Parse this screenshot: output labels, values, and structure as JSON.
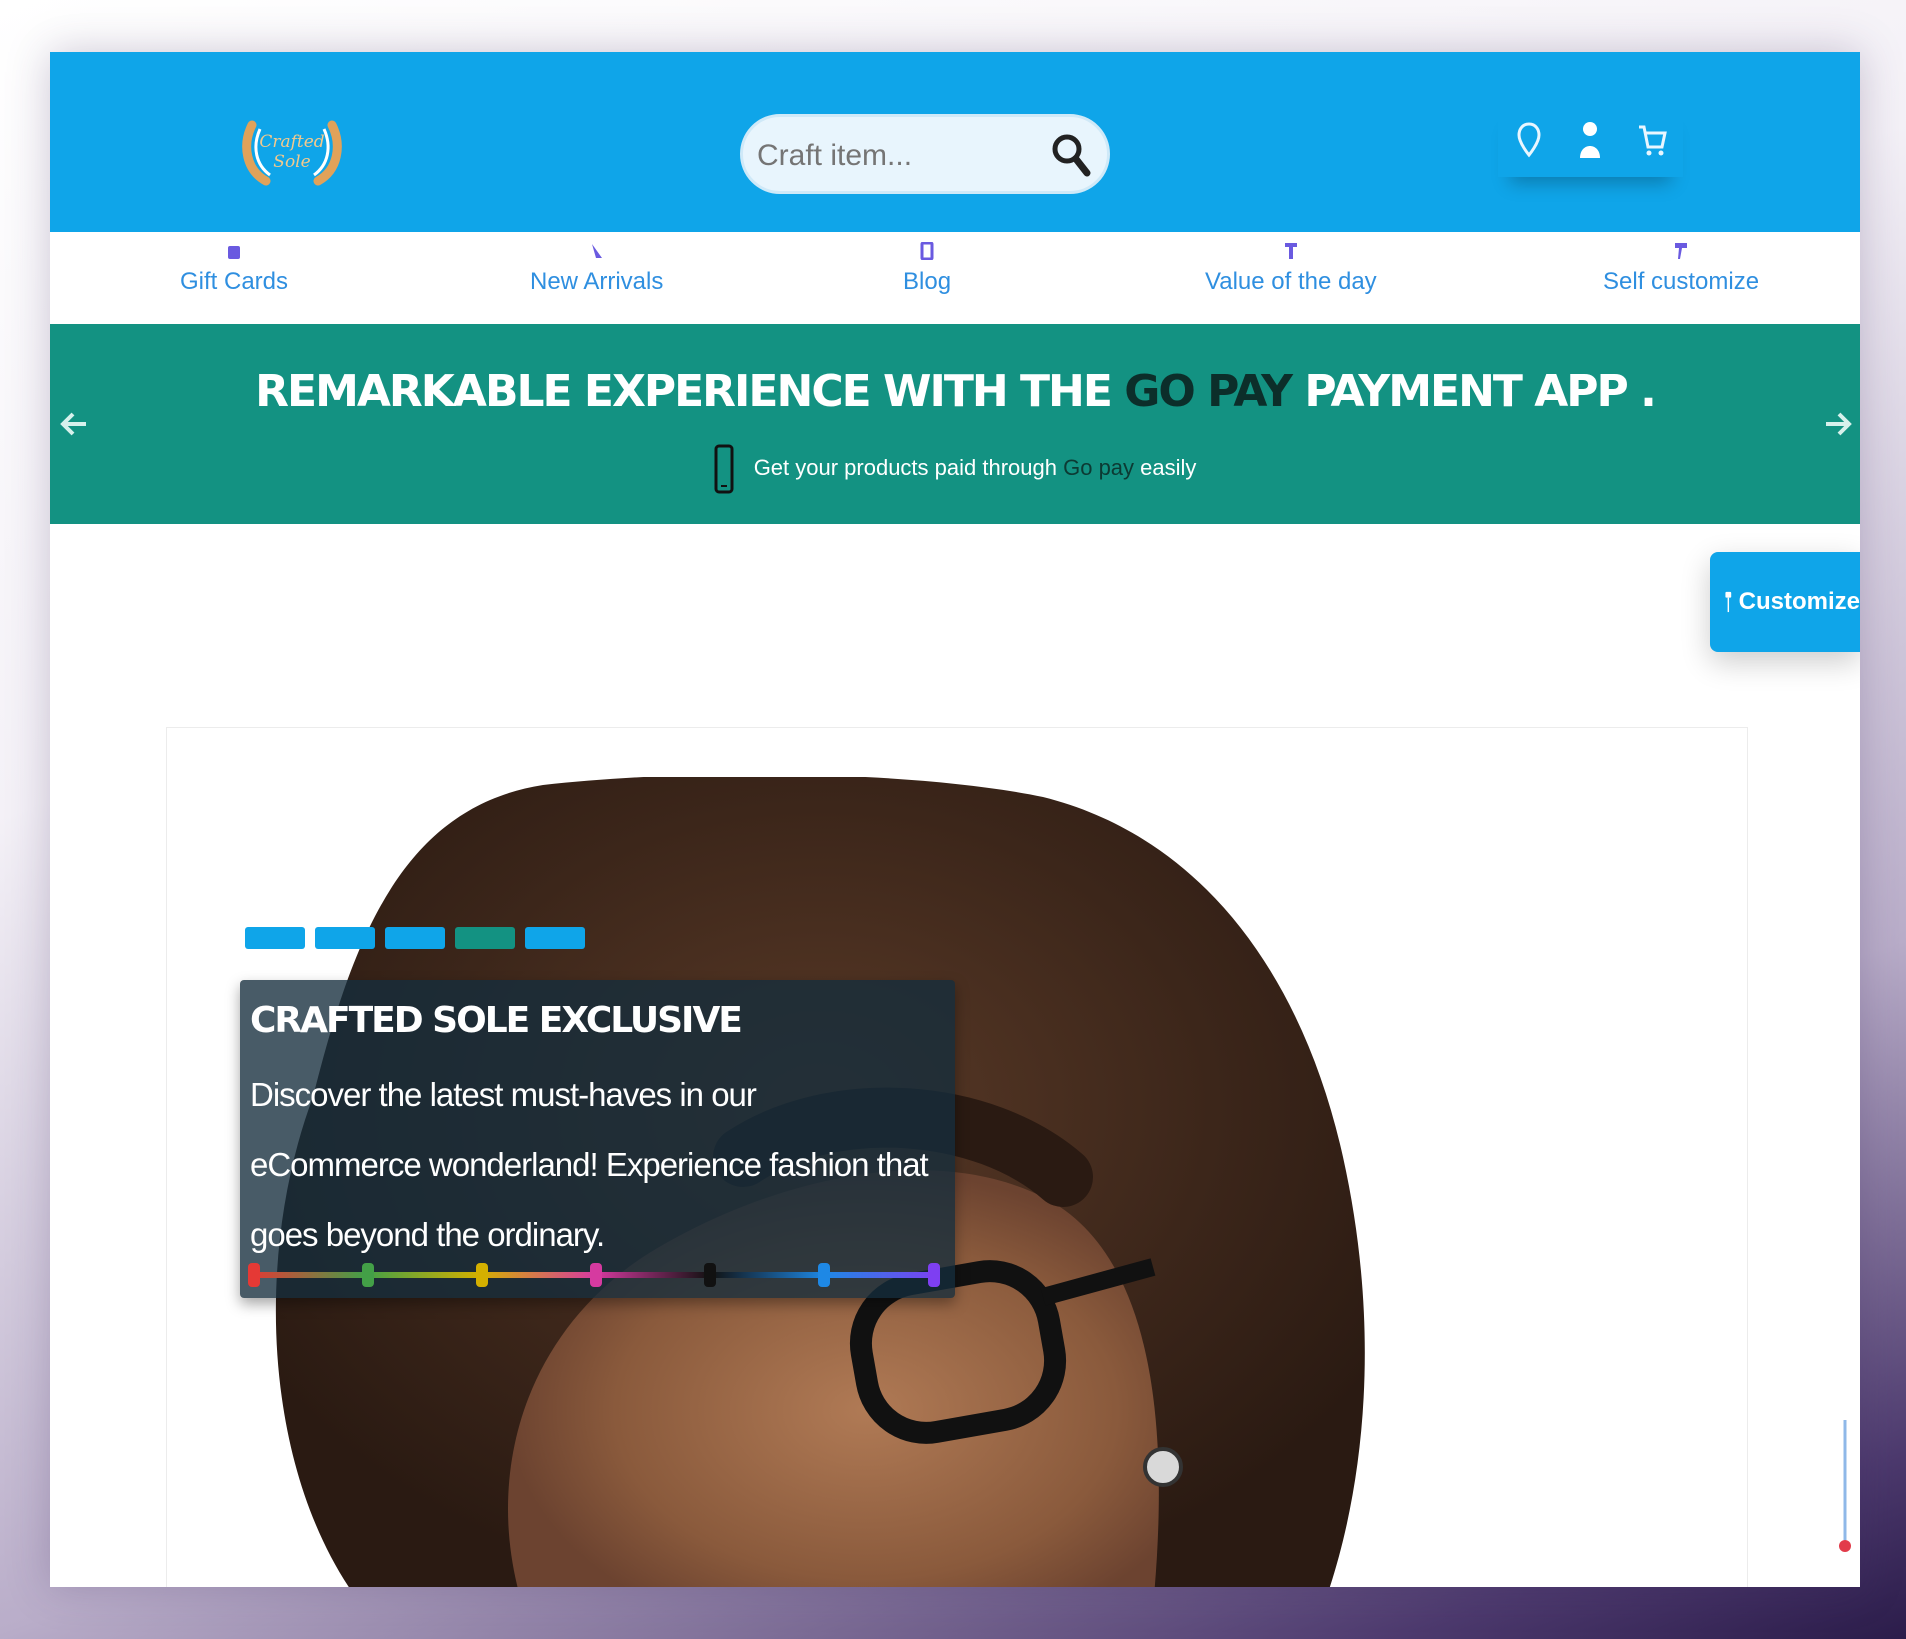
{
  "header": {
    "logo_alt": "Crafted Sole",
    "search": {
      "placeholder": "Craft item...",
      "value": ""
    },
    "icons": [
      "location-icon",
      "user-icon",
      "cart-icon"
    ]
  },
  "nav": {
    "items": [
      {
        "label": "Gift Cards",
        "icon": "gift-icon"
      },
      {
        "label": "New Arrivals",
        "icon": "new-icon"
      },
      {
        "label": "Blog",
        "icon": "blog-icon"
      },
      {
        "label": "Value of the day",
        "icon": "tag-icon"
      },
      {
        "label": "Self customize",
        "icon": "brush-icon"
      }
    ]
  },
  "promo": {
    "title_pre": "REMARKABLE EXPERIENCE WITH THE",
    "title_brand": "GO PAY",
    "title_post": "PAYMENT APP .",
    "sub_pre": "Get your products paid through",
    "sub_brand": "Go pay",
    "sub_post": "easily"
  },
  "customize": {
    "label": "Customize"
  },
  "hero": {
    "title": "CRAFTED SOLE EXCLUSIVE",
    "text": "Discover the latest must-haves in our eCommerce wonderland! Experience fashion that goes beyond the ordinary.",
    "slides": 5,
    "active_slide": 4,
    "palette": [
      "#e53935",
      "#43a047",
      "#d4b000",
      "#d63aa0",
      "#111111",
      "#1e88e5",
      "#7e3ff2"
    ]
  },
  "colors": {
    "header_bg": "#0fa5e9",
    "promo_bg": "#139282",
    "nav_text": "#2f8fe0"
  }
}
